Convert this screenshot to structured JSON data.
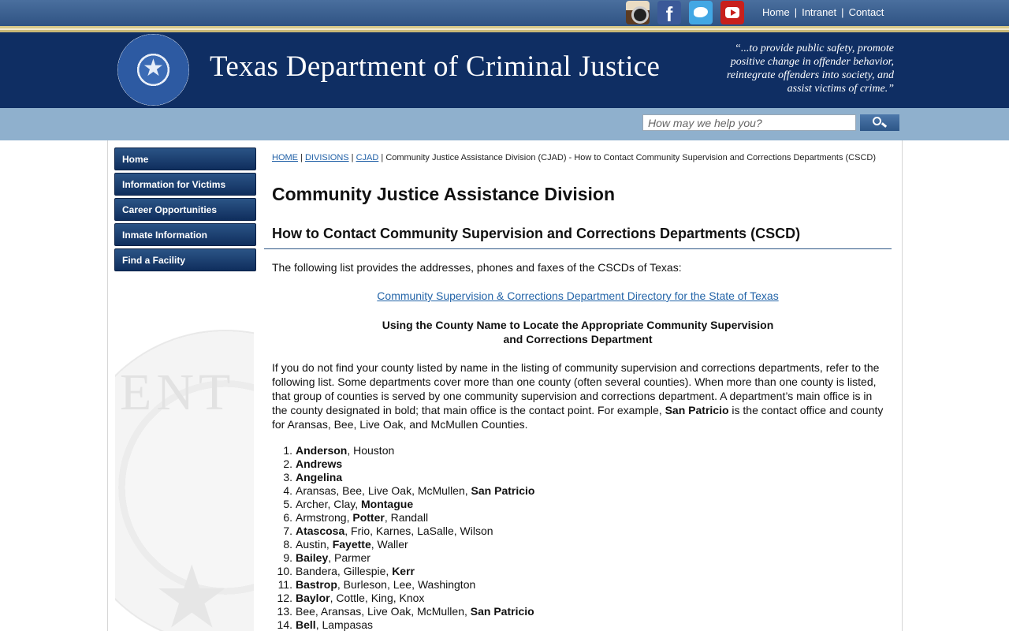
{
  "top_links": [
    "Home",
    "Intranet",
    "Contact"
  ],
  "social": {
    "facebook_glyph": "f"
  },
  "header": {
    "agency_name": "Texas Department of Criminal Justice",
    "mission": "“...to provide public safety, promote positive change in offender behavior, reintegrate offenders into society, and assist victims of crime.”"
  },
  "search": {
    "placeholder": "How may we help you?"
  },
  "nav": [
    "Home",
    "Information for Victims",
    "Career Opportunities",
    "Inmate Information",
    "Find a Facility"
  ],
  "breadcrumb": {
    "links": [
      "HOME",
      "DIVISIONS",
      "CJAD"
    ],
    "current": "Community Justice Assistance Division (CJAD) - How to Contact Community Supervision and Corrections Departments (CSCD)"
  },
  "page": {
    "title": "Community Justice Assistance Division",
    "subtitle": "How to Contact Community Supervision and Corrections Departments (CSCD)",
    "intro": "The following list provides the addresses, phones and faxes of the CSCDs of Texas:",
    "directory_link": "Community Supervision & Corrections Department Directory for the State of Texas",
    "subhead_line1": "Using the County Name to Locate the Appropriate Community Supervision",
    "subhead_line2": "and Corrections Department",
    "para_text": "If you do not find your county listed by name in the listing of community supervision and corrections departments, refer to the following list. Some departments cover more than one county (often several counties). When more than one county is listed, that group of counties is served by one community supervision and corrections department. A department’s main office is in the county designated in bold; that main office is the contact point. For example, ",
    "para_bold": "San Patricio",
    "para_tail": " is the contact office and county for Aransas, Bee, Live Oak, and McMullen Counties."
  },
  "counties": [
    {
      "num": "1.",
      "pre": "",
      "bold": "Anderson",
      "post": ", Houston"
    },
    {
      "num": "2.",
      "pre": "",
      "bold": "Andrews",
      "post": ""
    },
    {
      "num": "3.",
      "pre": "",
      "bold": "Angelina",
      "post": ""
    },
    {
      "num": "4.",
      "pre": "Aransas, Bee, Live Oak, McMullen, ",
      "bold": "San Patricio",
      "post": ""
    },
    {
      "num": "5.",
      "pre": "Archer, Clay, ",
      "bold": "Montague",
      "post": ""
    },
    {
      "num": "6.",
      "pre": "Armstrong, ",
      "bold": "Potter",
      "post": ", Randall"
    },
    {
      "num": "7.",
      "pre": "",
      "bold": "Atascosa",
      "post": ", Frio, Karnes, LaSalle, Wilson"
    },
    {
      "num": "8.",
      "pre": "Austin, ",
      "bold": "Fayette",
      "post": ", Waller"
    },
    {
      "num": "9.",
      "pre": "",
      "bold": "Bailey",
      "post": ", Parmer"
    },
    {
      "num": "10.",
      "pre": "Bandera, Gillespie, ",
      "bold": "Kerr",
      "post": ""
    },
    {
      "num": "11.",
      "pre": "",
      "bold": "Bastrop",
      "post": ", Burleson, Lee, Washington"
    },
    {
      "num": "12.",
      "pre": "",
      "bold": "Baylor",
      "post": ", Cottle, King, Knox"
    },
    {
      "num": "13.",
      "pre": "Bee, Aransas, Live Oak, McMullen, ",
      "bold": "San Patricio",
      "post": ""
    },
    {
      "num": "14.",
      "pre": "",
      "bold": "Bell",
      "post": ", Lampasas"
    }
  ]
}
